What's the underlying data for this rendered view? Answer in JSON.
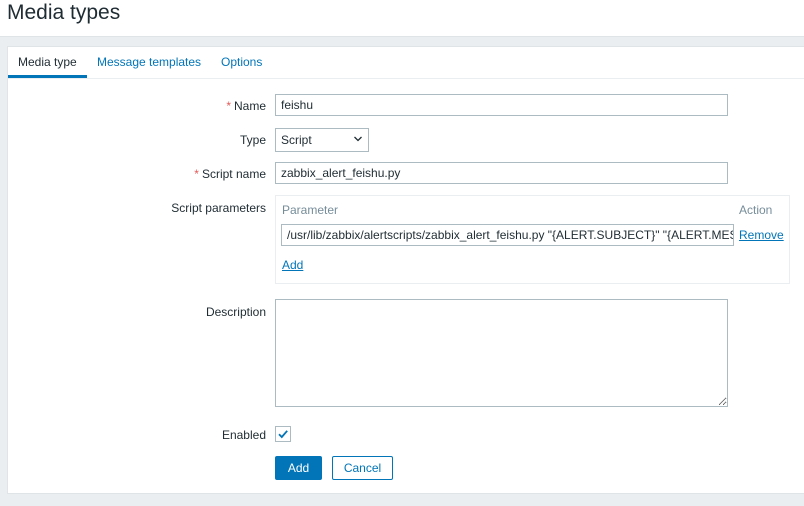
{
  "page": {
    "title": "Media types"
  },
  "tabs": [
    {
      "label": "Media type",
      "active": true
    },
    {
      "label": "Message templates",
      "active": false
    },
    {
      "label": "Options",
      "active": false
    }
  ],
  "form": {
    "name": {
      "label": "Name",
      "required": true,
      "value": "feishu"
    },
    "type": {
      "label": "Type",
      "value": "Script",
      "chevron_icon": "chevron-down-icon"
    },
    "script_name": {
      "label": "Script name",
      "required": true,
      "value": "zabbix_alert_feishu.py"
    },
    "script_parameters": {
      "label": "Script parameters",
      "col_parameter": "Parameter",
      "col_action": "Action",
      "rows": [
        {
          "value": "/usr/lib/zabbix/alertscripts/zabbix_alert_feishu.py  \"{ALERT.SUBJECT}\" \"{ALERT.MESSAGE}\"",
          "action": "Remove"
        }
      ],
      "add_label": "Add"
    },
    "description": {
      "label": "Description",
      "value": ""
    },
    "enabled": {
      "label": "Enabled",
      "checked": true
    }
  },
  "buttons": {
    "add": "Add",
    "cancel": "Cancel"
  },
  "colors": {
    "accent": "#0275b8",
    "required": "#e45959",
    "background": "#ebeef0"
  }
}
